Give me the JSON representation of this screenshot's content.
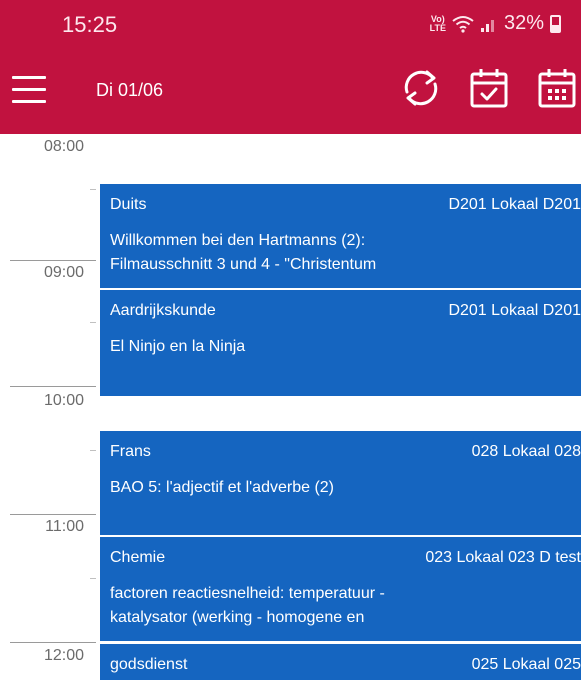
{
  "status": {
    "time": "15:25",
    "volte": "Vo)\nLTE",
    "signal": "••▏",
    "battery": "32%"
  },
  "appbar": {
    "date": "Di 01/06"
  },
  "timeline": {
    "hours": [
      "08:00",
      "09:00",
      "10:00",
      "11:00",
      "12:00"
    ]
  },
  "events": [
    {
      "subject": "Duits",
      "room": "D201 Lokaal D201",
      "desc": "Willkommen bei den Hartmanns (2):\nFilmausschnitt 3 und 4 - \"Christentum"
    },
    {
      "subject": "Aardrijkskunde",
      "room": "D201 Lokaal D201",
      "desc": "El Ninjo en la Ninja"
    },
    {
      "subject": "Frans",
      "room": "028 Lokaal 028",
      "desc": "BAO 5: l'adjectif et l'adverbe (2)"
    },
    {
      "subject": "Chemie",
      "room": "023 Lokaal 023 D test",
      "desc": "factoren reactiesnelheid: temperatuur -\nkatalysator (werking - homogene en"
    },
    {
      "subject": "godsdienst",
      "room": "025 Lokaal 025",
      "desc": ""
    }
  ],
  "colors": {
    "header": "#c1123f",
    "event": "#1565c0",
    "time": "#6b6b6b"
  }
}
